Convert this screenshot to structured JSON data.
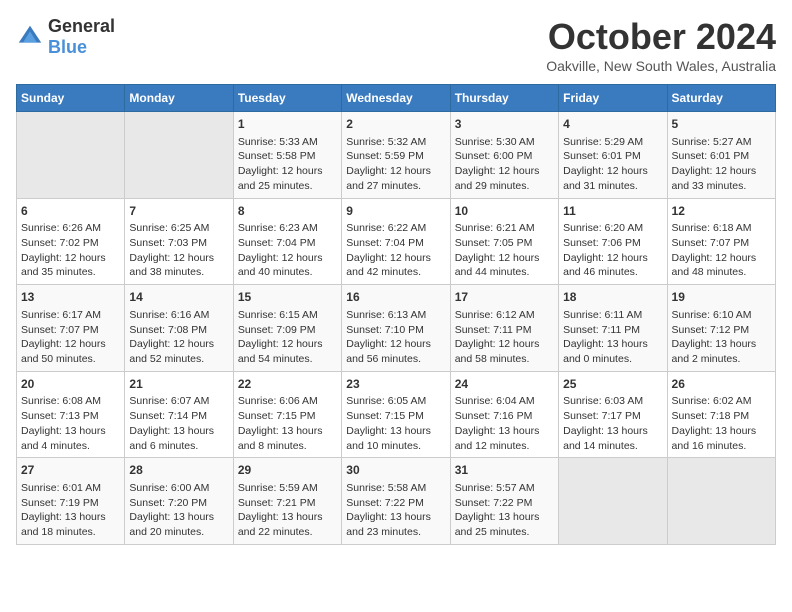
{
  "header": {
    "logo": {
      "general": "General",
      "blue": "Blue"
    },
    "title": "October 2024",
    "subtitle": "Oakville, New South Wales, Australia"
  },
  "days_of_week": [
    "Sunday",
    "Monday",
    "Tuesday",
    "Wednesday",
    "Thursday",
    "Friday",
    "Saturday"
  ],
  "weeks": [
    [
      {
        "day": null
      },
      {
        "day": null
      },
      {
        "day": 1,
        "sunrise": "Sunrise: 5:33 AM",
        "sunset": "Sunset: 5:58 PM",
        "daylight": "Daylight: 12 hours and 25 minutes."
      },
      {
        "day": 2,
        "sunrise": "Sunrise: 5:32 AM",
        "sunset": "Sunset: 5:59 PM",
        "daylight": "Daylight: 12 hours and 27 minutes."
      },
      {
        "day": 3,
        "sunrise": "Sunrise: 5:30 AM",
        "sunset": "Sunset: 6:00 PM",
        "daylight": "Daylight: 12 hours and 29 minutes."
      },
      {
        "day": 4,
        "sunrise": "Sunrise: 5:29 AM",
        "sunset": "Sunset: 6:01 PM",
        "daylight": "Daylight: 12 hours and 31 minutes."
      },
      {
        "day": 5,
        "sunrise": "Sunrise: 5:27 AM",
        "sunset": "Sunset: 6:01 PM",
        "daylight": "Daylight: 12 hours and 33 minutes."
      }
    ],
    [
      {
        "day": 6,
        "sunrise": "Sunrise: 6:26 AM",
        "sunset": "Sunset: 7:02 PM",
        "daylight": "Daylight: 12 hours and 35 minutes."
      },
      {
        "day": 7,
        "sunrise": "Sunrise: 6:25 AM",
        "sunset": "Sunset: 7:03 PM",
        "daylight": "Daylight: 12 hours and 38 minutes."
      },
      {
        "day": 8,
        "sunrise": "Sunrise: 6:23 AM",
        "sunset": "Sunset: 7:04 PM",
        "daylight": "Daylight: 12 hours and 40 minutes."
      },
      {
        "day": 9,
        "sunrise": "Sunrise: 6:22 AM",
        "sunset": "Sunset: 7:04 PM",
        "daylight": "Daylight: 12 hours and 42 minutes."
      },
      {
        "day": 10,
        "sunrise": "Sunrise: 6:21 AM",
        "sunset": "Sunset: 7:05 PM",
        "daylight": "Daylight: 12 hours and 44 minutes."
      },
      {
        "day": 11,
        "sunrise": "Sunrise: 6:20 AM",
        "sunset": "Sunset: 7:06 PM",
        "daylight": "Daylight: 12 hours and 46 minutes."
      },
      {
        "day": 12,
        "sunrise": "Sunrise: 6:18 AM",
        "sunset": "Sunset: 7:07 PM",
        "daylight": "Daylight: 12 hours and 48 minutes."
      }
    ],
    [
      {
        "day": 13,
        "sunrise": "Sunrise: 6:17 AM",
        "sunset": "Sunset: 7:07 PM",
        "daylight": "Daylight: 12 hours and 50 minutes."
      },
      {
        "day": 14,
        "sunrise": "Sunrise: 6:16 AM",
        "sunset": "Sunset: 7:08 PM",
        "daylight": "Daylight: 12 hours and 52 minutes."
      },
      {
        "day": 15,
        "sunrise": "Sunrise: 6:15 AM",
        "sunset": "Sunset: 7:09 PM",
        "daylight": "Daylight: 12 hours and 54 minutes."
      },
      {
        "day": 16,
        "sunrise": "Sunrise: 6:13 AM",
        "sunset": "Sunset: 7:10 PM",
        "daylight": "Daylight: 12 hours and 56 minutes."
      },
      {
        "day": 17,
        "sunrise": "Sunrise: 6:12 AM",
        "sunset": "Sunset: 7:11 PM",
        "daylight": "Daylight: 12 hours and 58 minutes."
      },
      {
        "day": 18,
        "sunrise": "Sunrise: 6:11 AM",
        "sunset": "Sunset: 7:11 PM",
        "daylight": "Daylight: 13 hours and 0 minutes."
      },
      {
        "day": 19,
        "sunrise": "Sunrise: 6:10 AM",
        "sunset": "Sunset: 7:12 PM",
        "daylight": "Daylight: 13 hours and 2 minutes."
      }
    ],
    [
      {
        "day": 20,
        "sunrise": "Sunrise: 6:08 AM",
        "sunset": "Sunset: 7:13 PM",
        "daylight": "Daylight: 13 hours and 4 minutes."
      },
      {
        "day": 21,
        "sunrise": "Sunrise: 6:07 AM",
        "sunset": "Sunset: 7:14 PM",
        "daylight": "Daylight: 13 hours and 6 minutes."
      },
      {
        "day": 22,
        "sunrise": "Sunrise: 6:06 AM",
        "sunset": "Sunset: 7:15 PM",
        "daylight": "Daylight: 13 hours and 8 minutes."
      },
      {
        "day": 23,
        "sunrise": "Sunrise: 6:05 AM",
        "sunset": "Sunset: 7:15 PM",
        "daylight": "Daylight: 13 hours and 10 minutes."
      },
      {
        "day": 24,
        "sunrise": "Sunrise: 6:04 AM",
        "sunset": "Sunset: 7:16 PM",
        "daylight": "Daylight: 13 hours and 12 minutes."
      },
      {
        "day": 25,
        "sunrise": "Sunrise: 6:03 AM",
        "sunset": "Sunset: 7:17 PM",
        "daylight": "Daylight: 13 hours and 14 minutes."
      },
      {
        "day": 26,
        "sunrise": "Sunrise: 6:02 AM",
        "sunset": "Sunset: 7:18 PM",
        "daylight": "Daylight: 13 hours and 16 minutes."
      }
    ],
    [
      {
        "day": 27,
        "sunrise": "Sunrise: 6:01 AM",
        "sunset": "Sunset: 7:19 PM",
        "daylight": "Daylight: 13 hours and 18 minutes."
      },
      {
        "day": 28,
        "sunrise": "Sunrise: 6:00 AM",
        "sunset": "Sunset: 7:20 PM",
        "daylight": "Daylight: 13 hours and 20 minutes."
      },
      {
        "day": 29,
        "sunrise": "Sunrise: 5:59 AM",
        "sunset": "Sunset: 7:21 PM",
        "daylight": "Daylight: 13 hours and 22 minutes."
      },
      {
        "day": 30,
        "sunrise": "Sunrise: 5:58 AM",
        "sunset": "Sunset: 7:22 PM",
        "daylight": "Daylight: 13 hours and 23 minutes."
      },
      {
        "day": 31,
        "sunrise": "Sunrise: 5:57 AM",
        "sunset": "Sunset: 7:22 PM",
        "daylight": "Daylight: 13 hours and 25 minutes."
      },
      {
        "day": null
      },
      {
        "day": null
      }
    ]
  ]
}
